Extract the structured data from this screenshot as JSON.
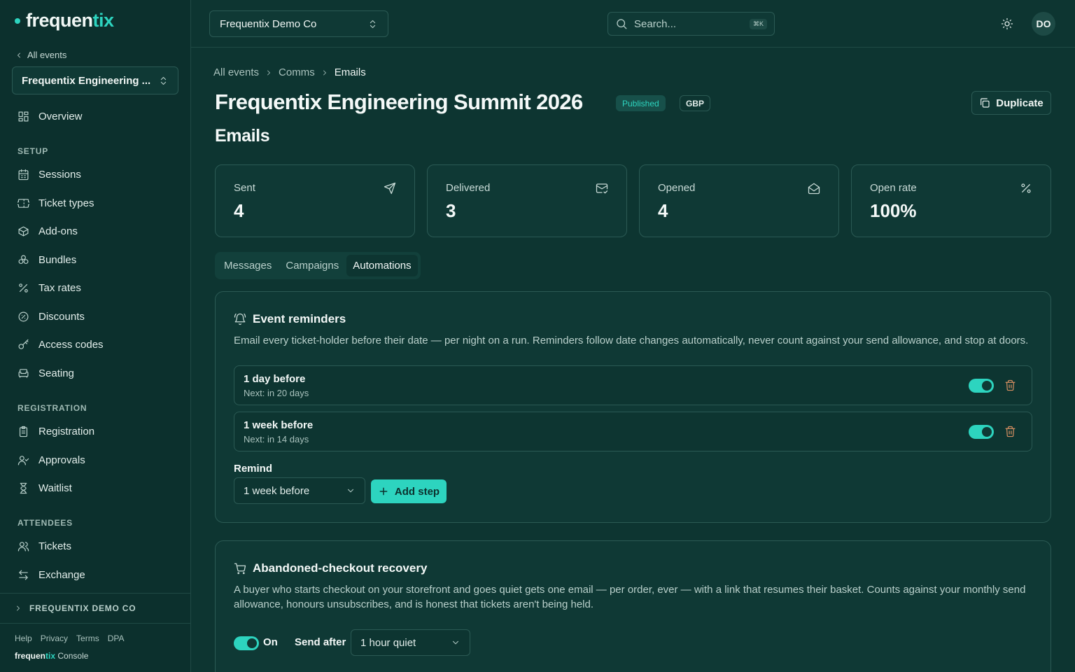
{
  "brand": {
    "name_main": "frequen",
    "name_accent": "tix",
    "console_label": "Console"
  },
  "sidebar": {
    "back_label": "All events",
    "event_select": "Frequentix Engineering ...",
    "overview": "Overview",
    "sections": {
      "setup": "SETUP",
      "registration": "REGISTRATION",
      "attendees": "ATTENDEES"
    },
    "setup_items": [
      "Sessions",
      "Ticket types",
      "Add-ons",
      "Bundles",
      "Tax rates",
      "Discounts",
      "Access codes",
      "Seating"
    ],
    "registration_items": [
      "Registration",
      "Approvals",
      "Waitlist"
    ],
    "attendee_items": [
      "Tickets",
      "Exchange"
    ],
    "org_row": "FREQUENTIX DEMO CO",
    "footer_links": [
      "Help",
      "Privacy",
      "Terms",
      "DPA"
    ]
  },
  "topbar": {
    "org_select": "Frequentix Demo Co",
    "search_placeholder": "Search...",
    "search_shortcut": "⌘K",
    "avatar_initials": "DO"
  },
  "breadcrumb": [
    "All events",
    "Comms",
    "Emails"
  ],
  "header": {
    "title": "Frequentix Engineering Summit 2026",
    "status_badge": "Published",
    "currency_badge": "GBP",
    "duplicate_label": "Duplicate",
    "section_title": "Emails"
  },
  "stats": [
    {
      "label": "Sent",
      "value": "4",
      "icon": "send-icon"
    },
    {
      "label": "Delivered",
      "value": "3",
      "icon": "mail-check-icon"
    },
    {
      "label": "Opened",
      "value": "4",
      "icon": "mail-open-icon"
    },
    {
      "label": "Open rate",
      "value": "100%",
      "icon": "percent-icon"
    }
  ],
  "tabs": {
    "messages": "Messages",
    "campaigns": "Campaigns",
    "automations": "Automations",
    "active": "Automations"
  },
  "reminders": {
    "title": "Event reminders",
    "description": "Email every ticket-holder before their date — per night on a run. Reminders follow date changes automatically, never count against your send allowance, and stop at doors.",
    "steps": [
      {
        "title": "1 day before",
        "next": "Next: in 20 days",
        "enabled": true
      },
      {
        "title": "1 week before",
        "next": "Next: in 14 days",
        "enabled": true
      }
    ],
    "remind_label": "Remind",
    "remind_value": "1 week before",
    "add_step_label": "Add step"
  },
  "abandoned": {
    "title": "Abandoned-checkout recovery",
    "description": "A buyer who starts checkout on your storefront and goes quiet gets one email — per order, ever — with a link that resumes their basket. Counts against your monthly send allowance, honours unsubscribes, and is honest that tickets aren't being held.",
    "enabled": true,
    "on_label": "On",
    "send_after_label": "Send after",
    "send_after_value": "1 hour quiet"
  },
  "colors": {
    "accent": "#2dd4bf",
    "background": "#0d3531",
    "danger_icon": "#d89062"
  }
}
